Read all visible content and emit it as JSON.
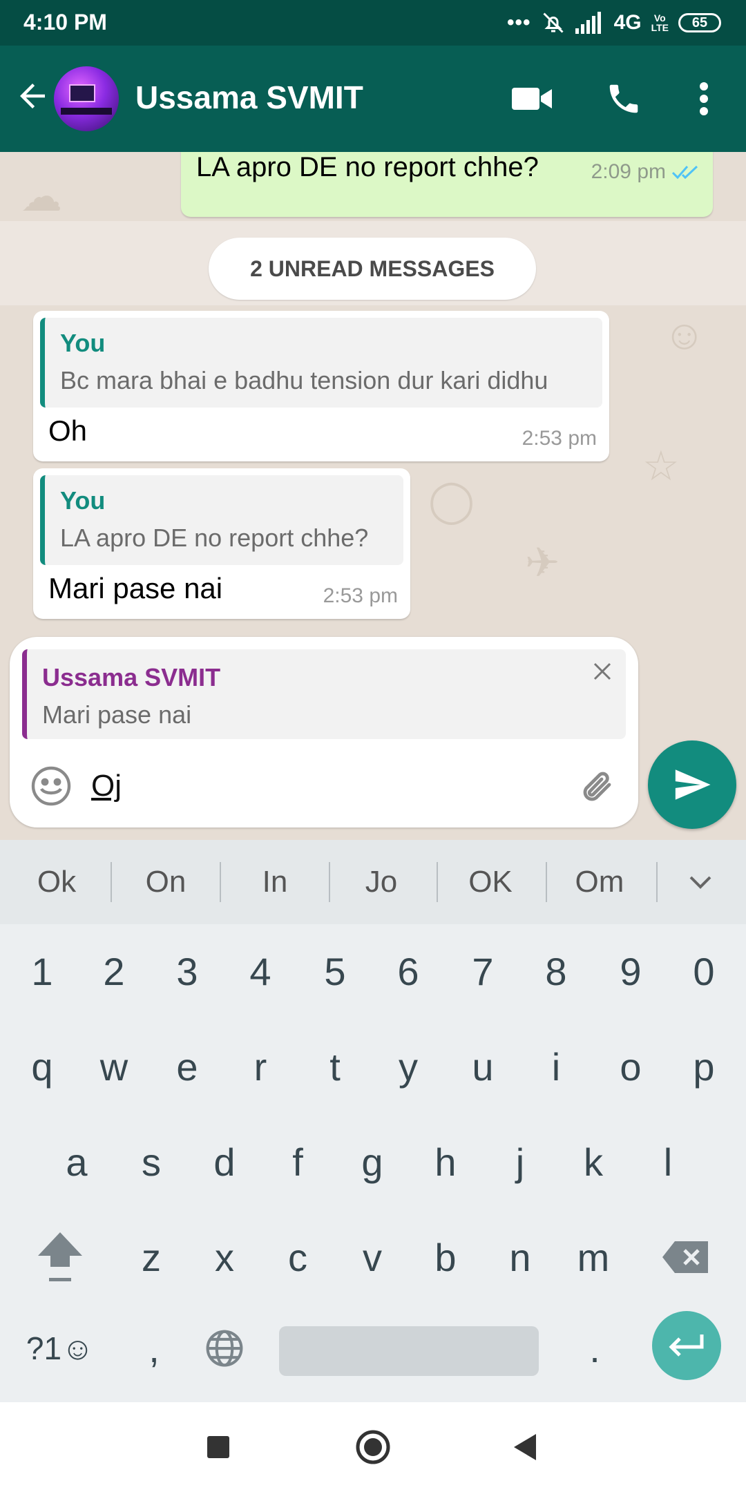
{
  "status_bar": {
    "time": "4:10 PM",
    "dots": "•••",
    "network": "4G",
    "volte_top": "Vo",
    "volte_bottom": "LTE",
    "battery": "65"
  },
  "header": {
    "contact_name": "Ussama SVMIT",
    "icons": [
      "back-arrow-icon",
      "video-call-icon",
      "phone-icon",
      "more-options-icon"
    ]
  },
  "chat": {
    "outgoing": {
      "text": "LA apro DE no report chhe?",
      "time": "2:09 pm",
      "status": "read"
    },
    "unread_banner": "2 UNREAD MESSAGES",
    "incoming": [
      {
        "quote_author": "You",
        "quote_text": "Bc mara bhai e badhu tension dur kari didhu",
        "text": "Oh",
        "time": "2:53 pm"
      },
      {
        "quote_author": "You",
        "quote_text": "LA apro DE no report chhe?",
        "text": "Mari pase nai",
        "time": "2:53 pm"
      }
    ]
  },
  "composer": {
    "reply_to_author": "Ussama SVMIT",
    "reply_to_text": "Mari pase nai",
    "input_value": "Oj"
  },
  "keyboard": {
    "suggestions": [
      "Ok",
      "On",
      "In",
      "Jo",
      "OK",
      "Om"
    ],
    "row_numbers": [
      "1",
      "2",
      "3",
      "4",
      "5",
      "6",
      "7",
      "8",
      "9",
      "0"
    ],
    "row1": [
      "q",
      "w",
      "e",
      "r",
      "t",
      "y",
      "u",
      "i",
      "o",
      "p"
    ],
    "row2": [
      "a",
      "s",
      "d",
      "f",
      "g",
      "h",
      "j",
      "k",
      "l"
    ],
    "row3": [
      "z",
      "x",
      "c",
      "v",
      "b",
      "n",
      "m"
    ],
    "symbols_key": "?1☺",
    "comma_key": ",",
    "period_key": "."
  },
  "colors": {
    "header": "#075e54",
    "status_bar": "#054d44",
    "outgoing_bubble": "#dcf8c6",
    "accent": "#128c7e",
    "reply_author": "#8b2d8f",
    "read_ticks": "#4fc3f7"
  }
}
